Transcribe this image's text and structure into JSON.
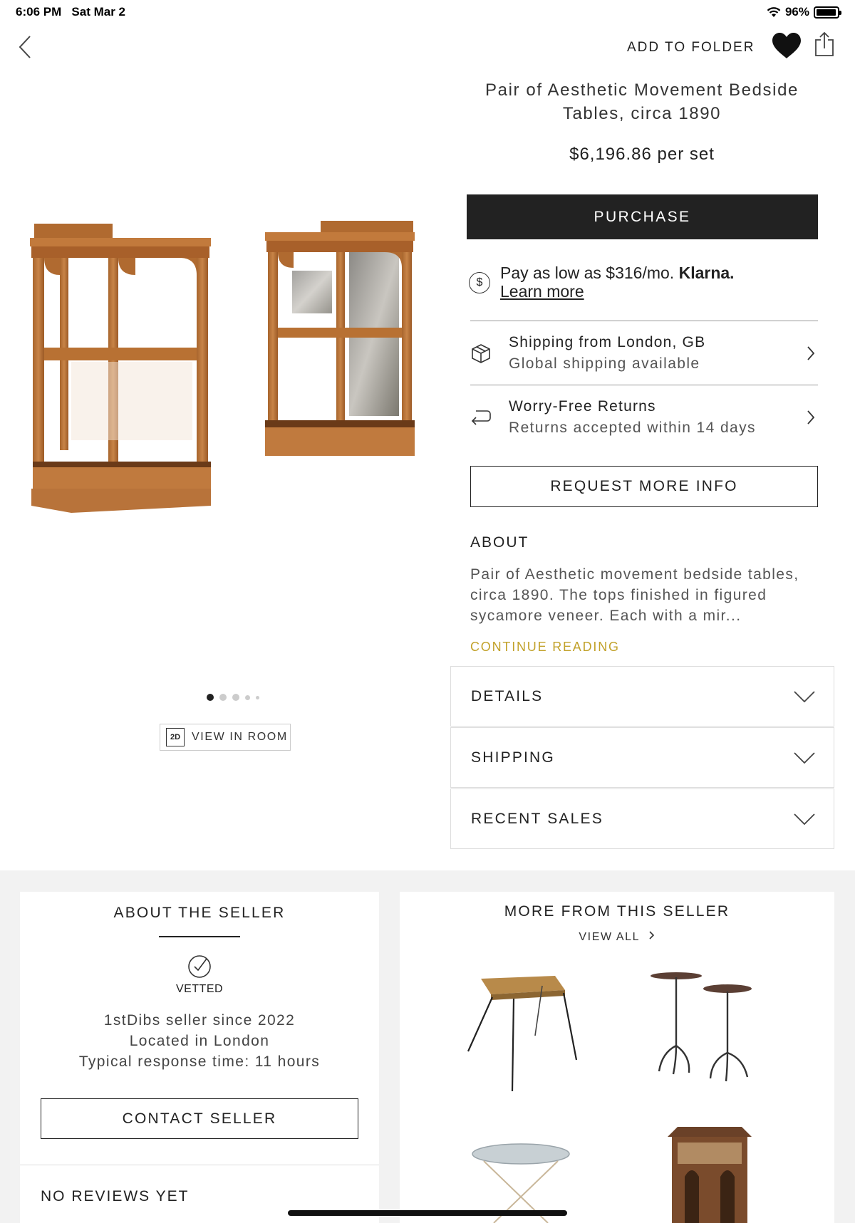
{
  "status_bar": {
    "time": "6:06 PM",
    "date": "Sat Mar 2",
    "battery": "96%",
    "battery_level": 0.96
  },
  "header": {
    "add_to_folder": "ADD TO FOLDER"
  },
  "product": {
    "title": "Pair of Aesthetic Movement Bedside Tables, circa 1890",
    "price": "$6,196.86 per set",
    "purchase_label": "PURCHASE",
    "klarna": {
      "text": "Pay as low as $316/mo.",
      "brand": "Klarna.",
      "link": "Learn more"
    },
    "shipping": {
      "line1": "Shipping from London, GB",
      "line2": "Global shipping available"
    },
    "returns": {
      "line1": "Worry-Free Returns",
      "line2": "Returns accepted within 14 days"
    },
    "request_label": "REQUEST MORE INFO",
    "about_heading": "ABOUT",
    "about_text": "Pair of Aesthetic movement bedside tables, circa 1890. The tops finished in figured sycamore veneer. Each with a mir...",
    "continue_reading": "CONTINUE READING"
  },
  "gallery": {
    "view_in_room": "VIEW IN ROOM",
    "badge": "2D",
    "dot_count": 5,
    "active_index": 0
  },
  "accordions": [
    {
      "label": "DETAILS"
    },
    {
      "label": "SHIPPING"
    },
    {
      "label": "RECENT SALES"
    }
  ],
  "seller": {
    "heading": "ABOUT THE SELLER",
    "vetted": "VETTED",
    "since": "1stDibs seller since 2022",
    "location": "Located in London",
    "response": "Typical response time: 11 hours",
    "contact_label": "CONTACT SELLER",
    "reviews": "NO REVIEWS YET"
  },
  "more_from_seller": {
    "heading": "MORE FROM THIS SELLER",
    "view_all": "VIEW ALL",
    "items": [
      "rattan-side-table",
      "pair-of-iron-tripod-tables",
      "glass-top-folding-table",
      "octagonal-inlaid-table"
    ]
  },
  "colors": {
    "purchase_bg": "#222222",
    "accent_gold": "#c2a22b",
    "section_bg": "#f2f2f2"
  }
}
